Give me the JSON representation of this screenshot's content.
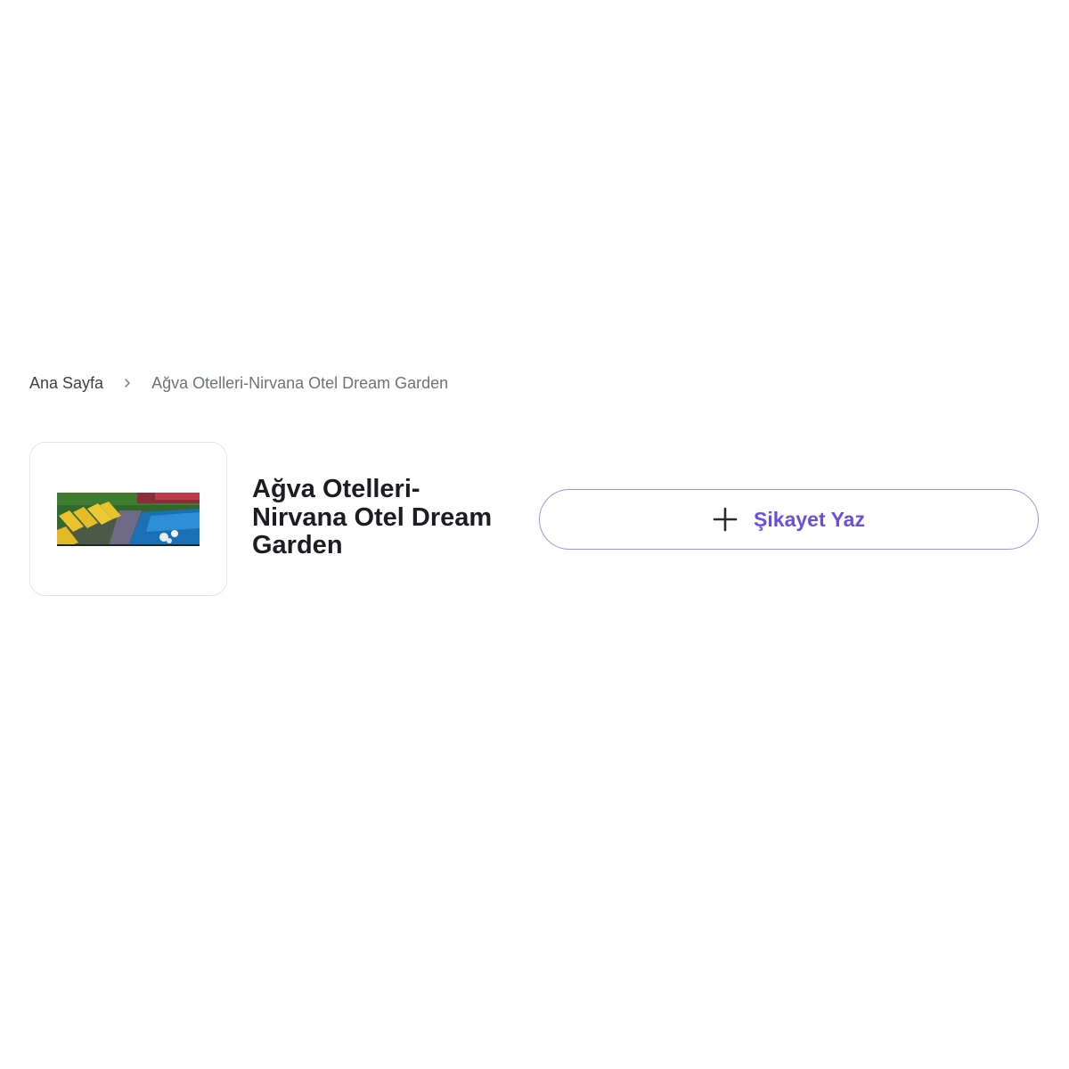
{
  "breadcrumb": {
    "home_label": "Ana Sayfa",
    "separator_icon": "chevron-right-icon",
    "current_label": "Ağva Otelleri-Nirvana Otel Dream Garden"
  },
  "company": {
    "name": "Ağva Otelleri-Nirvana Otel Dream Garden",
    "logo_alt": "pool-photo-logo"
  },
  "actions": {
    "complaint_button_label": "Şikayet Yaz",
    "complaint_button_icon": "plus-icon"
  },
  "colors": {
    "accent": "#6a4ee0",
    "accent_border": "#9a90f2",
    "title_text": "#1c1d22",
    "breadcrumb_home": "#3b3f4a",
    "breadcrumb_current": "#6e7280"
  }
}
